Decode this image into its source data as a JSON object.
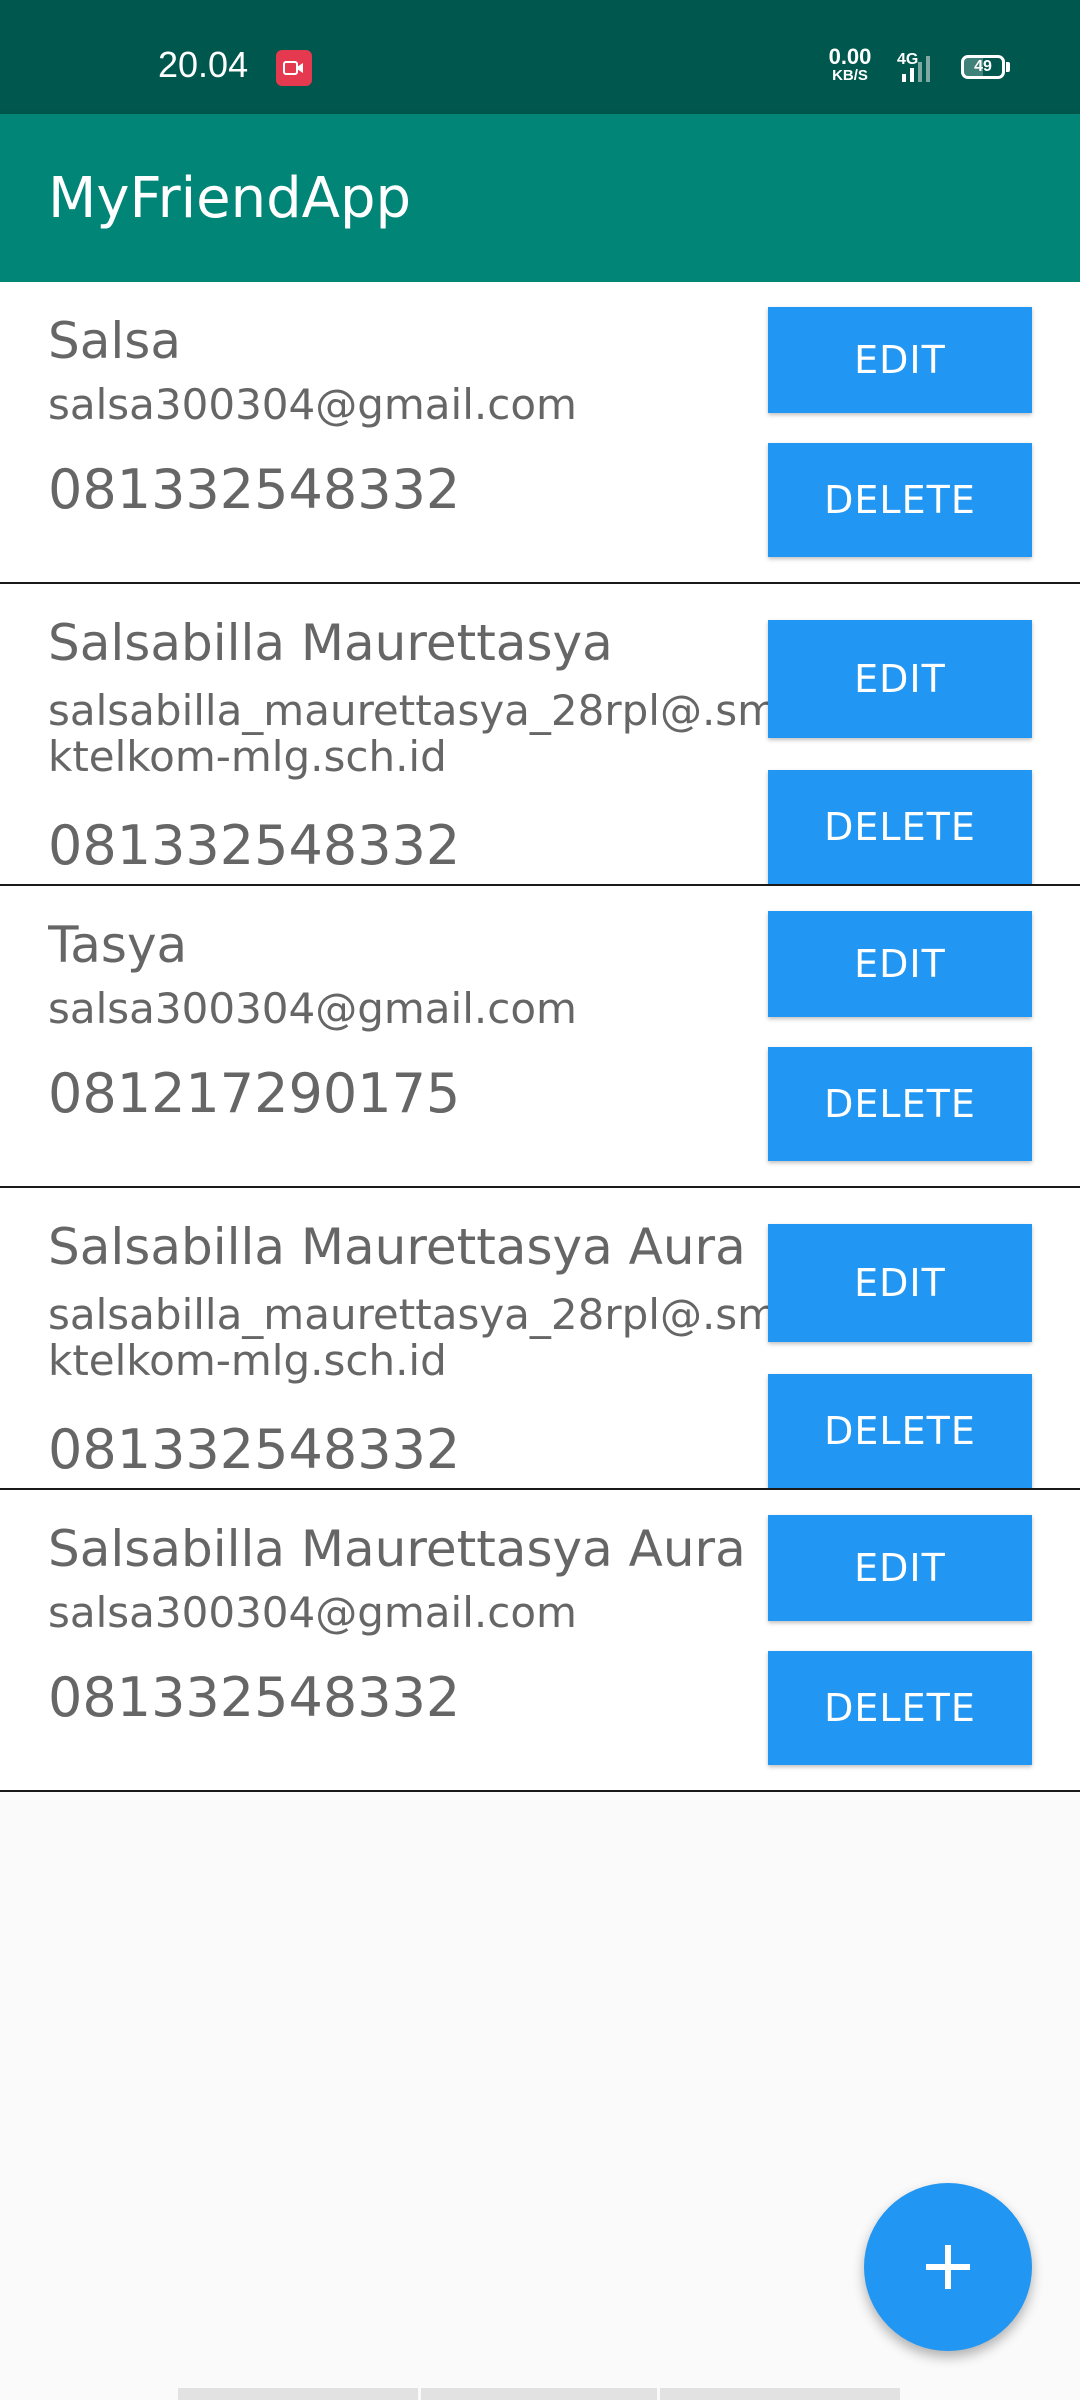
{
  "status_bar": {
    "time": "20.04",
    "net_speed_value": "0.00",
    "net_speed_unit": "KB/S",
    "network_type": "4G",
    "battery": "49",
    "record_icon": "screen-record-icon",
    "signal_icon": "signal-icon"
  },
  "app_bar": {
    "title": "MyFriendApp"
  },
  "friends": [
    {
      "name": "Salsa",
      "email": "salsa300304@gmail.com",
      "phone": "081332548332",
      "edit_label": "EDIT",
      "delete_label": "DELETE"
    },
    {
      "name": "Salsabilla Maurettasya",
      "email": "salsabilla_maurettasya_28rpl@.smktelkom-mlg.sch.id",
      "phone": "081332548332",
      "edit_label": "EDIT",
      "delete_label": "DELETE"
    },
    {
      "name": "Tasya",
      "email": "salsa300304@gmail.com",
      "phone": "081217290175",
      "edit_label": "EDIT",
      "delete_label": "DELETE"
    },
    {
      "name": "Salsabilla Maurettasya Aura",
      "email": "salsabilla_maurettasya_28rpl@.smktelkom-mlg.sch.id",
      "phone": "081332548332",
      "edit_label": "EDIT",
      "delete_label": "DELETE"
    },
    {
      "name": "Salsabilla Maurettasya Aura",
      "email": "salsa300304@gmail.com",
      "phone": "081332548332",
      "edit_label": "EDIT",
      "delete_label": "DELETE"
    }
  ],
  "fab": {
    "icon": "plus-icon"
  },
  "colors": {
    "status_bar": "#00574d",
    "app_bar": "#008577",
    "button": "#2196f3",
    "text": "#666666"
  }
}
